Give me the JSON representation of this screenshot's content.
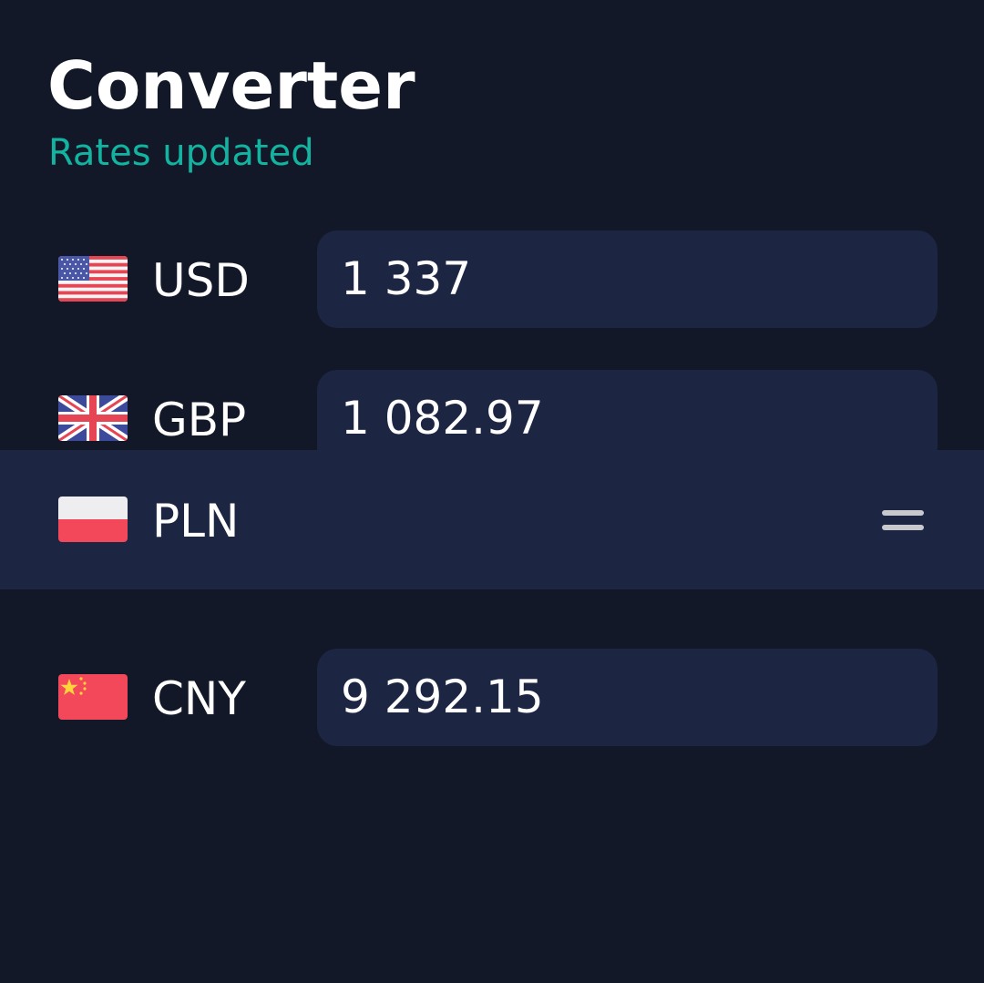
{
  "header": {
    "title": "Converter",
    "status": "Rates updated"
  },
  "colors": {
    "background": "#121827",
    "field": "#1c2541",
    "accent": "#12b3a0",
    "text": "#ffffff"
  },
  "currencies": [
    {
      "code": "USD",
      "flag_icon": "us-flag-icon",
      "amount": "1 337"
    },
    {
      "code": "GBP",
      "flag_icon": "uk-flag-icon",
      "amount": "1 082.97"
    },
    {
      "code": "PLN",
      "flag_icon": "pl-flag-icon",
      "amount": "",
      "state": "dragging",
      "handle_icon": "drag-handle-icon"
    },
    {
      "code": "CNY",
      "flag_icon": "cn-flag-icon",
      "amount": "9 292.15"
    }
  ]
}
